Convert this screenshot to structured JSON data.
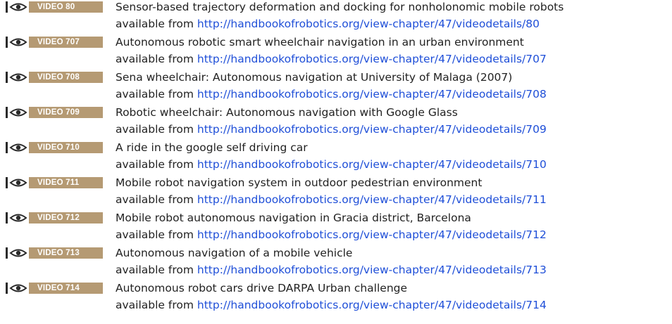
{
  "colors": {
    "badge_fill": "#b59a73",
    "badge_text": "#ffffff",
    "link": "#1f4fd8",
    "text": "#222222"
  },
  "badge_icon": "eye-icon",
  "entries": [
    {
      "badge": "VIDEO 80",
      "title": "Sensor-based trajectory deformation and docking for nonholonomic mobile robots",
      "prefix": "available from",
      "url": "http://handbookofrobotics.org/view-chapter/47/videodetails/80"
    },
    {
      "badge": "VIDEO 707",
      "title": "Autonomous robotic smart wheelchair navigation in an urban environment",
      "prefix": "available from",
      "url": "http://handbookofrobotics.org/view-chapter/47/videodetails/707"
    },
    {
      "badge": "VIDEO 708",
      "title": "Sena wheelchair: Autonomous navigation at University of Malaga (2007)",
      "prefix": "available from",
      "url": "http://handbookofrobotics.org/view-chapter/47/videodetails/708"
    },
    {
      "badge": "VIDEO 709",
      "title": "Robotic wheelchair: Autonomous navigation with Google Glass",
      "prefix": "available from",
      "url": "http://handbookofrobotics.org/view-chapter/47/videodetails/709"
    },
    {
      "badge": "VIDEO 710",
      "title": "A ride in the google self driving car",
      "prefix": "available from",
      "url": "http://handbookofrobotics.org/view-chapter/47/videodetails/710"
    },
    {
      "badge": "VIDEO 711",
      "title": "Mobile robot navigation system in outdoor pedestrian environment",
      "prefix": "available from",
      "url": "http://handbookofrobotics.org/view-chapter/47/videodetails/711"
    },
    {
      "badge": "VIDEO 712",
      "title": "Mobile robot autonomous navigation in Gracia district, Barcelona",
      "prefix": "available from",
      "url": "http://handbookofrobotics.org/view-chapter/47/videodetails/712"
    },
    {
      "badge": "VIDEO 713",
      "title": "Autonomous navigation of a mobile vehicle",
      "prefix": "available from",
      "url": "http://handbookofrobotics.org/view-chapter/47/videodetails/713"
    },
    {
      "badge": "VIDEO 714",
      "title": "Autonomous robot cars drive DARPA Urban challenge",
      "prefix": "available from",
      "url": "http://handbookofrobotics.org/view-chapter/47/videodetails/714"
    }
  ]
}
